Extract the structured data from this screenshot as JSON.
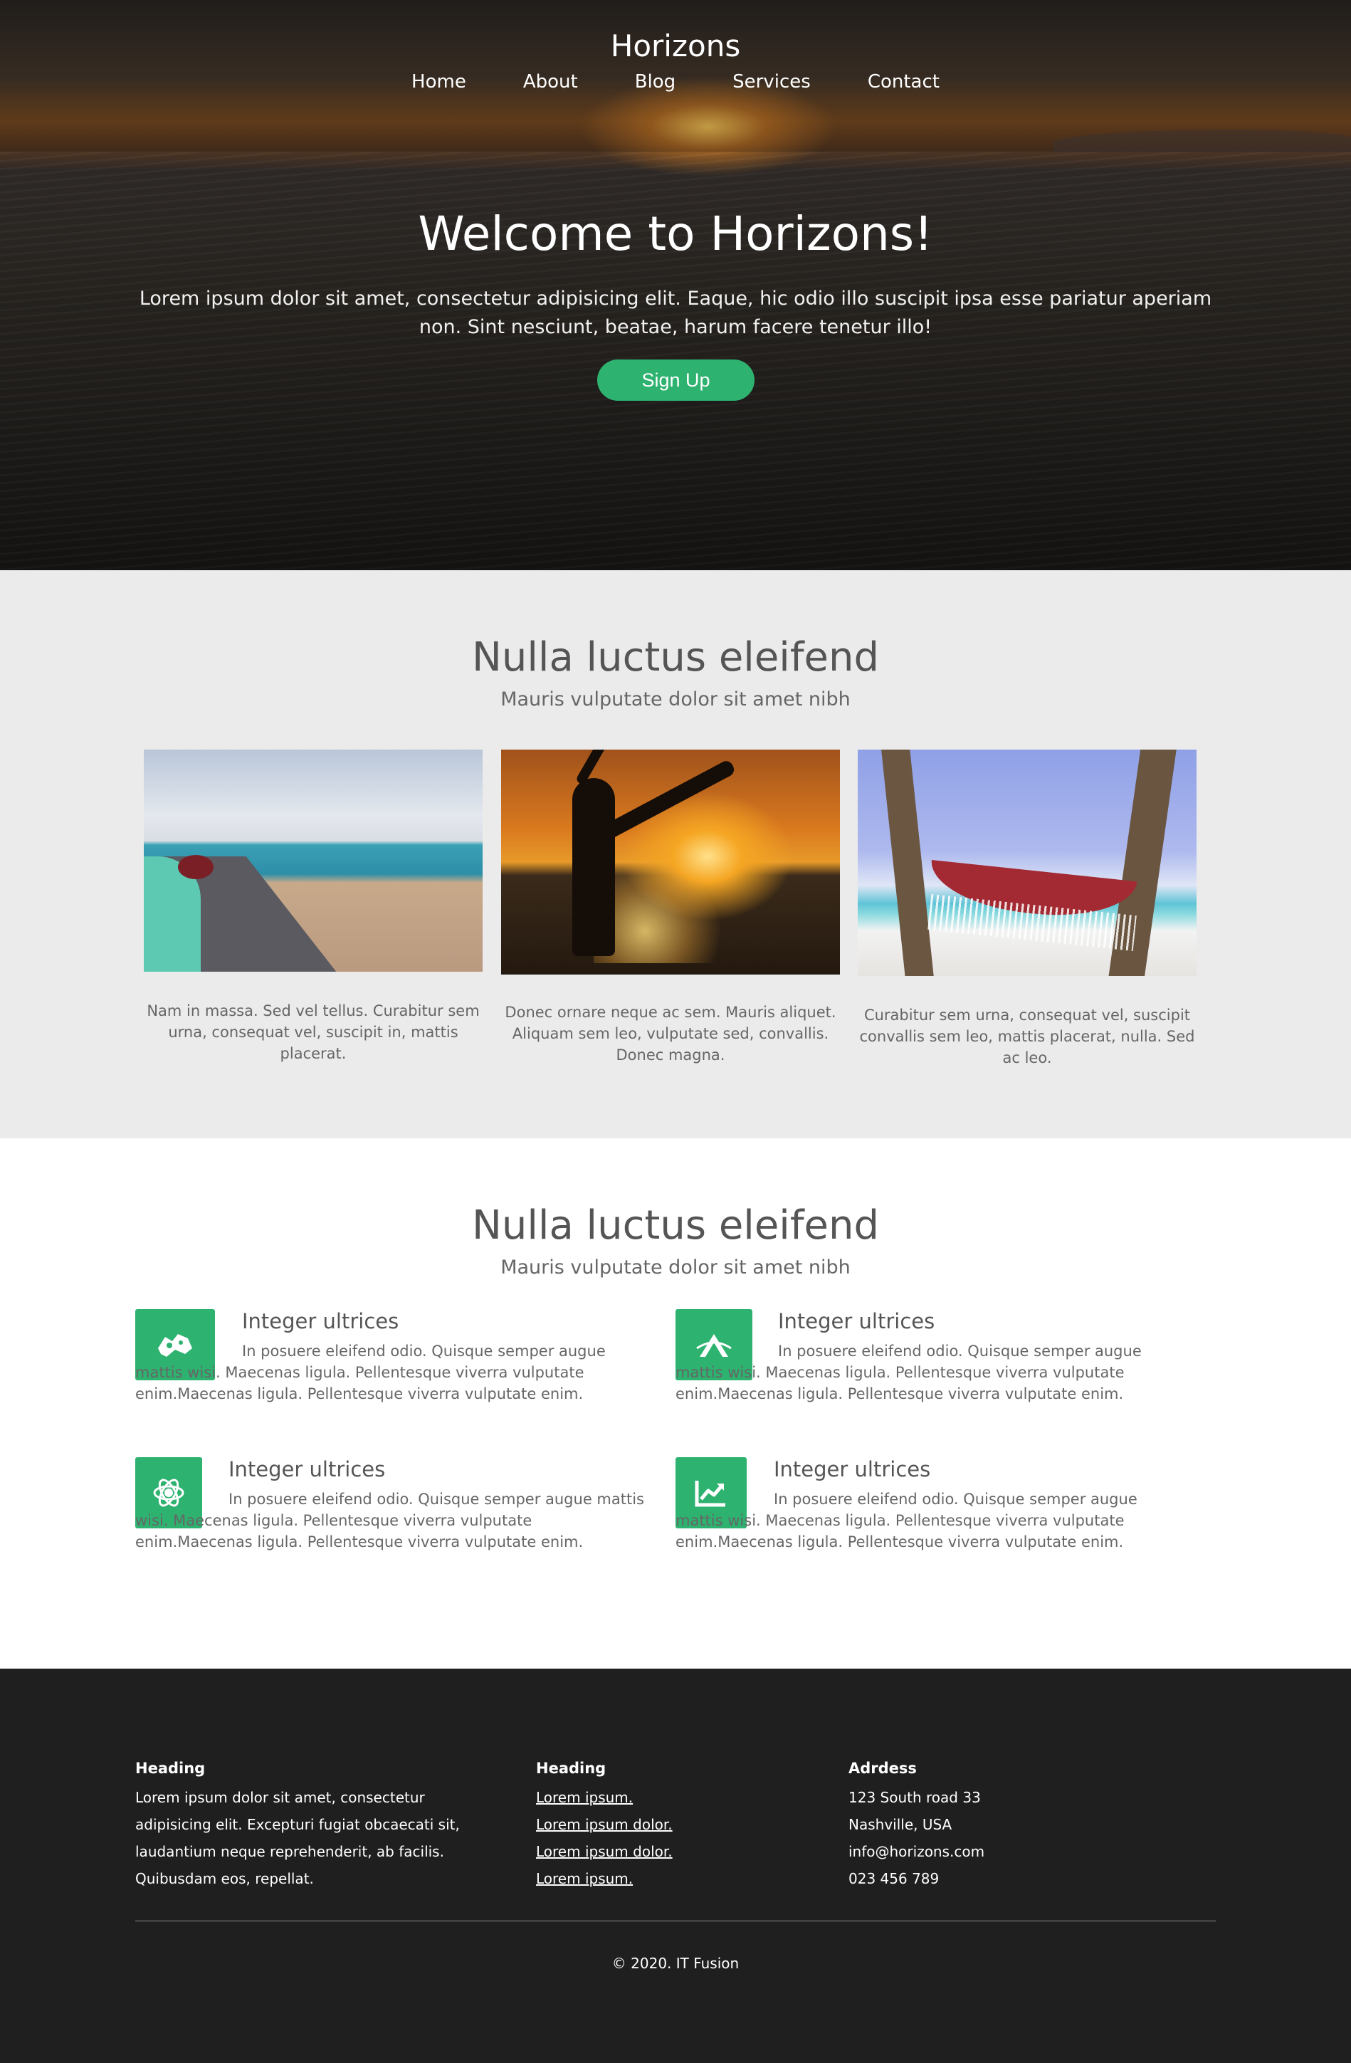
{
  "header": {
    "brand": "Horizons",
    "nav": [
      "Home",
      "About",
      "Blog",
      "Services",
      "Contact"
    ]
  },
  "hero": {
    "title": "Welcome to Horizons!",
    "text": "Lorem ipsum dolor sit amet, consectetur adipisicing elit. Eaque, hic odio illo suscipit ipsa esse pariatur aperiam non. Sint nesciunt, beatae, harum facere tenetur illo!",
    "cta": "Sign Up"
  },
  "gallery": {
    "title": "Nulla luctus eleifend",
    "subtitle": "Mauris vulputate dolor sit amet nibh",
    "cards": [
      {
        "image": "road-by-the-sea",
        "text": "Nam in massa. Sed vel tellus. Curabitur sem urna, consequat vel, suscipit in, mattis placerat."
      },
      {
        "image": "sunset-kick-silhouette",
        "text": "Donec ornare neque ac sem. Mauris aliquet. Aliquam sem leo, vulputate sed, convallis. Donec magna."
      },
      {
        "image": "beach-hammock",
        "text": "Curabitur sem urna, consequat vel, suscipit convallis sem leo, mattis placerat, nulla. Sed ac leo."
      }
    ]
  },
  "features": {
    "title": "Nulla luctus eleifend",
    "subtitle": "Mauris vulputate dolor sit amet nibh",
    "items": [
      {
        "icon": "map-icon",
        "title": "Integer ultrices",
        "text": "In posuere eleifend odio. Quisque semper augue mattis wisi. Maecenas ligula. Pellentesque viverra vulputate enim.Maecenas ligula. Pellentesque viverra vulputate enim."
      },
      {
        "icon": "mountain-icon",
        "title": "Integer ultrices",
        "text": "In posuere eleifend odio. Quisque semper augue mattis wisi. Maecenas ligula. Pellentesque viverra vulputate enim.Maecenas ligula. Pellentesque viverra vulputate enim."
      },
      {
        "icon": "atom-gear-icon",
        "title": "Integer ultrices",
        "text": "In posuere eleifend odio. Quisque semper augue mattis wisi. Maecenas ligula. Pellentesque viverra vulputate enim.Maecenas ligula. Pellentesque viverra vulputate enim."
      },
      {
        "icon": "chart-line-icon",
        "title": "Integer ultrices",
        "text": "In posuere eleifend odio. Quisque semper augue mattis wisi. Maecenas ligula. Pellentesque viverra vulputate enim.Maecenas ligula. Pellentesque viverra vulputate enim."
      }
    ]
  },
  "footer": {
    "col1": {
      "heading": "Heading",
      "text": "Lorem ipsum dolor sit amet, consectetur adipisicing elit. Excepturi fugiat obcaecati sit, laudantium neque reprehenderit, ab facilis. Quibusdam eos, repellat."
    },
    "col2": {
      "heading": "Heading",
      "links": [
        "Lorem ipsum.",
        "Lorem ipsum dolor.",
        "Lorem ipsum dolor.",
        "Lorem ipsum."
      ]
    },
    "col3": {
      "heading": "Adrdess",
      "lines": [
        "123 South road 33",
        "Nashville, USA",
        "info@horizons.com",
        "023 456 789"
      ]
    },
    "copyright": "© 2020. IT Fusion"
  },
  "colors": {
    "accent": "#2db270",
    "gallery_bg": "#ebebeb",
    "footer_bg": "#1f1f1f"
  }
}
